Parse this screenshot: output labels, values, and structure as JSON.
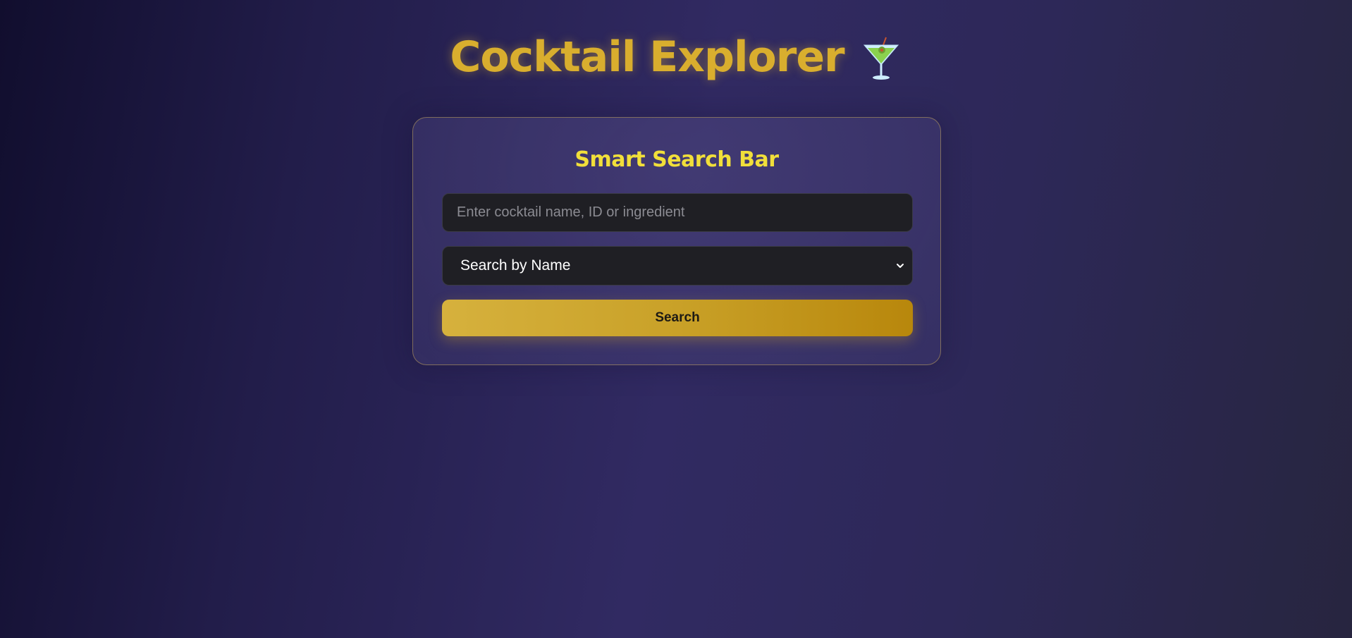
{
  "header": {
    "title": "Cocktail Explorer",
    "icon": "cocktail-glass-icon"
  },
  "search_card": {
    "heading": "Smart Search Bar",
    "input": {
      "value": "",
      "placeholder": "Enter cocktail name, ID or ingredient"
    },
    "select": {
      "selected": "Search by Name",
      "icon": "chevron-down-icon"
    },
    "button_label": "Search"
  },
  "colors": {
    "title": "#d9ae2e",
    "heading": "#f1df3a",
    "button_start": "#d6b13d",
    "button_end": "#b8870c",
    "field_bg": "#1f1f24"
  }
}
